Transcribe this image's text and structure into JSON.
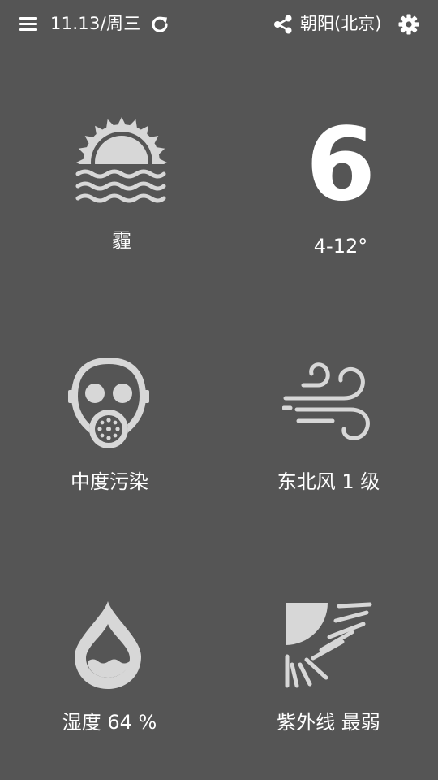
{
  "header": {
    "date": "11.13/周三",
    "location": "朝阳(北京)"
  },
  "weather": {
    "condition": "霾",
    "condition_icon": "haze-sun-icon",
    "temperature": "6",
    "temp_range": "4-12°"
  },
  "pollution": {
    "label": "中度污染",
    "icon": "gas-mask-icon"
  },
  "wind": {
    "label": "东北风 1 级",
    "icon": "wind-icon"
  },
  "humidity": {
    "label": "湿度 64 %",
    "icon": "water-drop-icon"
  },
  "uv": {
    "label": "紫外线 最弱",
    "icon": "sun-rays-icon"
  },
  "colors": {
    "background": "#555555",
    "icon": "#d7d7d7",
    "text": "#ffffff"
  }
}
